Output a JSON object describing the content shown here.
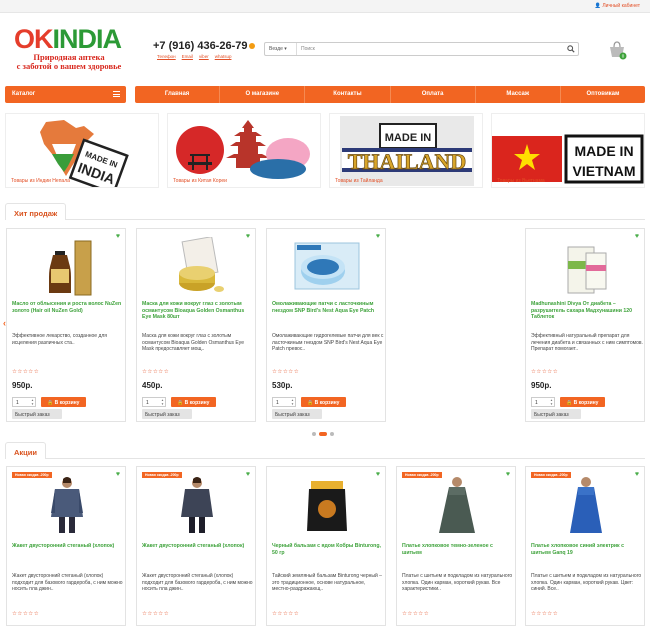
{
  "header": {
    "account": "Личный кабинет",
    "logo_ok": "OK",
    "logo_india": "INDIA",
    "tagline_1": "Природная аптека",
    "tagline_2": "с заботой о вашем здоровье",
    "phone": "+7 (916) 436-26-79",
    "contacts": [
      "Телефон",
      "Email",
      "viber",
      "whatsup"
    ],
    "search_category": "Везде",
    "search_placeholder": "Поиск",
    "cart_count": "0"
  },
  "nav": {
    "catalog": "Каталог",
    "items": [
      "Главная",
      "О магазине",
      "Контакты",
      "Оплата",
      "Массаж",
      "Оптовикам"
    ]
  },
  "banners": [
    {
      "caption": "Товары из Индии Непала",
      "text": "MADE IN INDIA"
    },
    {
      "caption": "Товары из Китая Кореи",
      "text": ""
    },
    {
      "caption": "Товары из Тайланда",
      "text": "MADE IN THAILAND"
    },
    {
      "caption": "Товары из Вьетнама",
      "text": "MADE IN VIETNAM"
    }
  ],
  "bestsellers": {
    "title": "Хит продаж",
    "products": [
      {
        "name": "Масло от облысения и роста волос NuZen золото (Hair oil NuZen Gold)",
        "desc": "Эффективное лекарство, созданное для исцеления различных ста..",
        "price": "950р."
      },
      {
        "name": "Маска для кожи вокруг глаз с золотым османтусом Bioaqua Golden Osmanthus Eye Mask 80шт",
        "desc": "Маска для кожи вокруг глаз с золотым османтусом Bioaqua Golden Osmanthus Eye Mask предоставляет мощ..",
        "price": "450р."
      },
      {
        "name": "Омолаживающие патчи с ласточкиным гнездом SNP Bird's Nest Aqua Eye Patch",
        "desc": "Омолаживающие гидрогелевые патчи для век с ласточкиным гнездом SNP Bird's Nest Aqua Eye Patch превос..",
        "price": "530р."
      },
      {
        "name": "Madhunashini Divya От диабета – разрушитель сахара Мадхунашини 120 Таблеток",
        "desc": "Эффективный натуральный препарат для лечения диабета и связанных с ним симптомов. Препарат помогает..",
        "price": "950р."
      }
    ]
  },
  "promo": {
    "title": "Акции",
    "sale_badges": [
      "Новая скидка -200р",
      "Новая скидка -200р",
      "",
      "Новая скидка -200р",
      "Новая скидка -200р"
    ],
    "products": [
      {
        "name": "Жакет двусторонний стеганый (хлопок)",
        "desc": "Жакет двусторонний стеганый (хлопок) подходит для базового гардероба, с ним можно носить пла джин.."
      },
      {
        "name": "Жакет двусторонний стеганый (хлопок)",
        "desc": "Жакет двусторонний стеганый (хлопок) подходит для базового гардероба, с ним можно носить пла джин.."
      },
      {
        "name": "Черный бальзам с ядом Кобры Binturong, 50 гр",
        "desc": "Тайский земляный бальзам Binturong черный – это традиционное, основе натуральное, местно-раздражающ.."
      },
      {
        "name": "Платье хлопковое темно-зеленое с шитьем",
        "desc": "Платье с шитьем и подкладом из натурального хлопка. Один карман, короткий рукав. Все характеристики.."
      },
      {
        "name": "Платье хлопковое синий электрик с шитьем Ganq 19",
        "desc": "Платье с шитьем и подкладом из натурального хлопка. Один карман, короткий рукав. Цвет: синий. Все.."
      }
    ]
  },
  "labels": {
    "add_to_cart": "В корзину",
    "quick_order": "Быстрый заказ",
    "qty": "1",
    "stars": "☆☆☆☆☆"
  },
  "colors": {
    "accent": "#f26522",
    "green": "#3ea23b",
    "red": "#e53d2b"
  }
}
